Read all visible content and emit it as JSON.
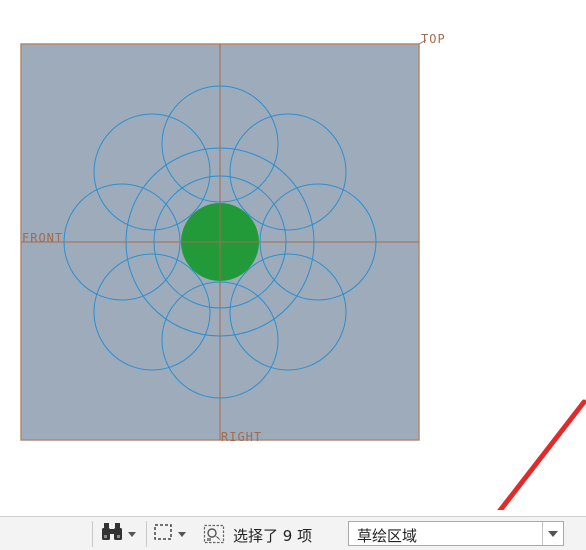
{
  "viewport": {
    "datums": {
      "top": "TOP",
      "front": "FRONT",
      "right": "RIGHT"
    },
    "colors": {
      "background": "#9eabba",
      "frame": "#b08a70",
      "circle_stroke": "#2a8fd0",
      "fill": "#239a3a",
      "datum_line": "#a06c50",
      "datum_text": "#a06c50",
      "annotation_arrow": "#e02b2b"
    }
  },
  "statusbar": {
    "find_icon": "binoculars-icon",
    "select_box_icon": "dashed-rectangle-icon",
    "selection_icon": "selected-items-icon",
    "selection_status": "选择了 9 项",
    "filter": {
      "selected": "草绘区域"
    }
  }
}
